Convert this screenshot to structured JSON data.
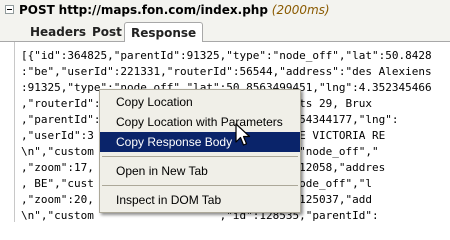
{
  "request": {
    "method": "POST",
    "url": "http://maps.fon.com/index.php",
    "time": "(2000ms)"
  },
  "tabs": [
    {
      "label": "Headers"
    },
    {
      "label": "Post"
    },
    {
      "label": "Response"
    }
  ],
  "response_text": "[{\"id\":364825,\"parentId\":91325,\"type\":\"node_off\",\"lat\":50.8428\n:\"be\",\"userId\":221331,\"routerId\":56544,\"address\":\"des Alexiens\n:91325,\"type\":\"node_off\",\"lat\":50.8563499451,\"lng\":4.352345466\n,\"routerId\":                  mmer\\u00e7ants 29, Brux\n,\"parentId\":                  ,\"lat\":50.8554344177,\"lng\":\n,\"userId\":3                   ress\":\"SQUARE VICTORIA RE\n\\n\",\"custom                   :728,\"type\":\"node_off\",\"\n,\"zoom\":17,                   ,\"routerId\":12058,\"addres\n, BE\",\"cust                   56,\"type\":\"node_off\",\"l\n,\"zoom\":20,                   ,\"routerId\":125037,\"add\n\\n\",\"custom                   ,\"id\":128535,\"parentId\":\n,\"lng\":4.34240674972,\"zoom\":20,\"country\":\"be\",\"userId\":96181,",
  "context_menu": {
    "items": [
      {
        "label": "Copy Location"
      },
      {
        "label": "Copy Location with Parameters"
      },
      {
        "label": "Copy Response Body"
      },
      {
        "label": "Open in New Tab"
      },
      {
        "label": "Inspect in DOM Tab"
      }
    ],
    "highlighted": "Copy Response Body"
  },
  "colors": {
    "menu_highlight": "#0a246a",
    "time_text": "#8a5a00"
  }
}
